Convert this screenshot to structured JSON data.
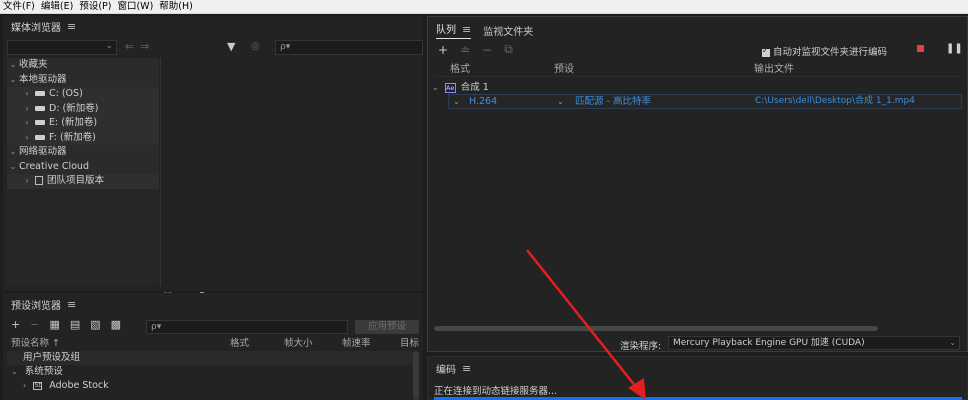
{
  "menubar": {
    "items": [
      "文件(F)",
      "编辑(E)",
      "预设(P)",
      "窗口(W)",
      "帮助(H)"
    ]
  },
  "media_browser": {
    "title": "媒体浏览器",
    "search_placeholder": "ρ▾",
    "tree": [
      {
        "label": "收藏夹",
        "type": "section"
      },
      {
        "label": "本地驱动器",
        "type": "section"
      },
      {
        "label": "C: (OS)",
        "type": "drive"
      },
      {
        "label": "D: (新加卷)",
        "type": "drive"
      },
      {
        "label": "E: (新加卷)",
        "type": "drive"
      },
      {
        "label": "F: (新加卷)",
        "type": "drive"
      },
      {
        "label": "网络驱动器",
        "type": "section"
      },
      {
        "label": "Creative Cloud",
        "type": "section"
      },
      {
        "label": "团队项目版本",
        "type": "item"
      }
    ]
  },
  "preset_browser": {
    "title": "预设浏览器",
    "search_placeholder": "ρ▾",
    "apply_label": "应用预设",
    "columns": [
      "预设名称 ↑",
      "格式",
      "帧大小",
      "帧速率",
      "目标"
    ],
    "rows": [
      {
        "label": "用户预设及组"
      },
      {
        "label": "系统预设"
      },
      {
        "label": "Adobe Stock"
      }
    ]
  },
  "queue": {
    "tabs": [
      "队列",
      "监视文件夹"
    ],
    "auto_watch_label": "自动对监视文件夹进行编码",
    "columns": [
      "格式",
      "预设",
      "输出文件"
    ],
    "group_label": "合成 1",
    "group_badge": "Ae",
    "job": {
      "format": "H.264",
      "preset": "匹配源 - 高比特率",
      "output": "C:\\Users\\dell\\Desktop\\合成 1_1.mp4"
    },
    "renderer_label": "渲染程序:",
    "renderer_value": "Mercury Playback Engine GPU 加速 (CUDA)"
  },
  "encoding": {
    "title": "编码",
    "status": "正在连接到动态链接服务器..."
  },
  "colors": {
    "accent": "#1473e6",
    "link": "#3e8ee0",
    "stop": "#e04040",
    "annotation_arrow": "#e02020"
  }
}
